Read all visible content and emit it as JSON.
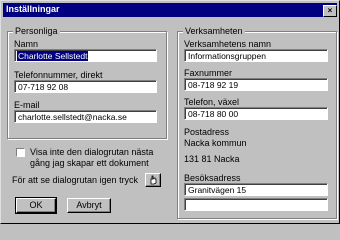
{
  "window": {
    "title": "Inställningar",
    "close": "×"
  },
  "personal": {
    "legend": "Personliga",
    "name_label": "Namn",
    "name_value": "Charlotte Sellstedt",
    "phone_label": "Telefonnummer, direkt",
    "phone_value": "07-718 92 08",
    "email_label": "E-mail",
    "email_value": "charlotte.sellstedt@nacka.se"
  },
  "business": {
    "legend": "Verksamheten",
    "name_label": "Verksamhetens namn",
    "name_value": "Informationsgruppen",
    "fax_label": "Faxnummer",
    "fax_value": "08-718 92 19",
    "phone_label": "Telefon, växel",
    "phone_value": "08-718 80 00",
    "postal_label": "Postadress",
    "postal_line1": "Nacka kommun",
    "postal_line2": "131 81 Nacka",
    "visit_label": "Besöksadress",
    "visit_value1": "Granitvägen 15",
    "visit_value2": ""
  },
  "options": {
    "checkbox_label_1": "Visa inte den dialogrutan nästa",
    "checkbox_label_2": "gång jag skapar ett dokument",
    "checkbox_checked": false,
    "reopen_text": "För att se dialogrutan igen tryck"
  },
  "buttons": {
    "ok": "OK",
    "cancel": "Avbryt"
  }
}
